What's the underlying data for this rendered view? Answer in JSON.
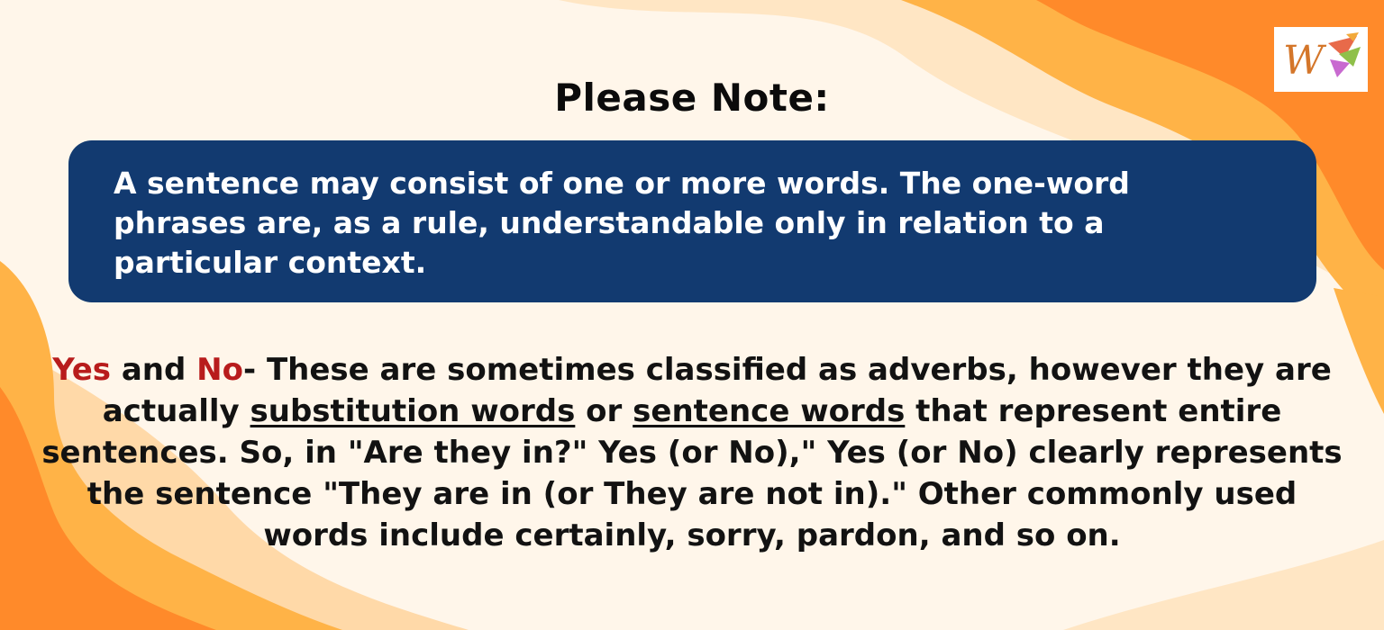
{
  "title": "Please Note:",
  "note": {
    "text": "A sentence may consist of one or more words. The one-word phrases are, as a rule, understandable only in relation to a particular context."
  },
  "body": {
    "yes": "Yes",
    "and": " and ",
    "no": "No",
    "intro": "- These are sometimes classified as adverbs, however they are actually ",
    "term1": "substitution words",
    "or": " or ",
    "term2": "sentence words",
    "rest": " that represent entire sentences. So, in \"Are they in?\" Yes (or No),\" Yes (or No) clearly represents the sentence \"They are in (or They are not in).\" Other commonly used words include certainly, sorry, pardon, and so on."
  },
  "logo": {
    "letter": "W"
  },
  "colors": {
    "background": "#fff6ea",
    "orange_dark": "#ff7a1f",
    "orange_light": "#ffb347",
    "peach": "#ffd7a6",
    "note_box": "#123a70",
    "highlight_red": "#b81c1c"
  }
}
